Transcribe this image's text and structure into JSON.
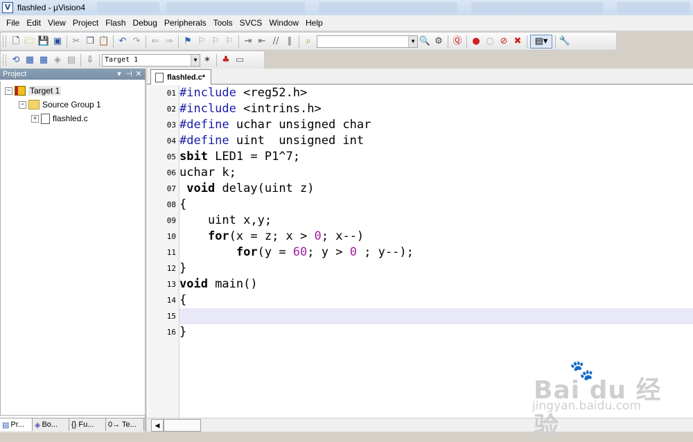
{
  "window": {
    "title": "flashled - µVision4",
    "app_icon": "uvision-icon"
  },
  "menu": [
    "File",
    "Edit",
    "View",
    "Project",
    "Flash",
    "Debug",
    "Peripherals",
    "Tools",
    "SVCS",
    "Window",
    "Help"
  ],
  "build_toolbar": {
    "target_select": "Target 1"
  },
  "project_panel": {
    "title": "Project",
    "tree": {
      "target": "Target 1",
      "group": "Source Group 1",
      "file": "flashled.c"
    },
    "bottom_tabs": [
      "Pr...",
      "Bo...",
      "{} Fu...",
      "0→ Te..."
    ]
  },
  "editor": {
    "tab_label": "flashled.c*",
    "line_numbers": [
      "01",
      "02",
      "03",
      "04",
      "05",
      "06",
      "07",
      "08",
      "09",
      "10",
      "11",
      "12",
      "13",
      "14",
      "15",
      "16"
    ],
    "lines": [
      "#include <reg52.h>",
      "#include <intrins.h>",
      "#define uchar unsigned char",
      "#define uint  unsigned int",
      "sbit LED1 = P1^7;",
      "uchar k;",
      " void delay(uint z)",
      "{",
      "    uint x,y;",
      "    for(x = z; x > 0; x--)",
      "        for(y = 60; y > 0 ; y--);",
      "}",
      "void main()",
      "{",
      "",
      "}"
    ],
    "current_line": "15"
  },
  "watermark": {
    "brand": "Bai du 经验",
    "url": "jingyan.baidu.com"
  }
}
